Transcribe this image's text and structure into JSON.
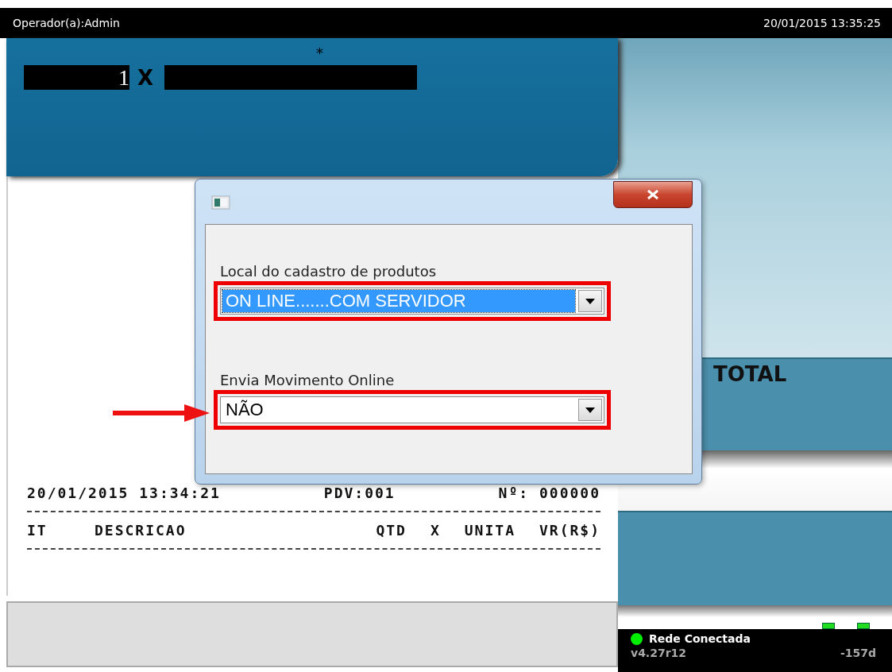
{
  "header": {
    "operator": "Operador(a):Admin",
    "datetime": "20/01/2015 13:35:25"
  },
  "entry": {
    "marker": "*",
    "quantity": "1",
    "times": "X"
  },
  "dialog": {
    "fields": [
      {
        "label": "Local do cadastro de produtos",
        "value": "ON LINE.......COM SERVIDOR",
        "focused": true,
        "highlighted": true
      },
      {
        "label": "Envia Movimento Online",
        "value": "NÃO",
        "focused": false,
        "highlighted": true,
        "arrow": true
      }
    ]
  },
  "receipt": {
    "info": [
      "20/01/2015 13:34:21",
      "PDV:001",
      "Nº: 000000"
    ],
    "columns": [
      "IT",
      "DESCRICAO",
      "QTD",
      "X",
      "UNITA",
      "VR(R$)"
    ]
  },
  "total_label": "TOTAL",
  "status": {
    "network": "Rede Conectada",
    "connected": true,
    "version": "v4.27r12",
    "days": "-157d"
  }
}
